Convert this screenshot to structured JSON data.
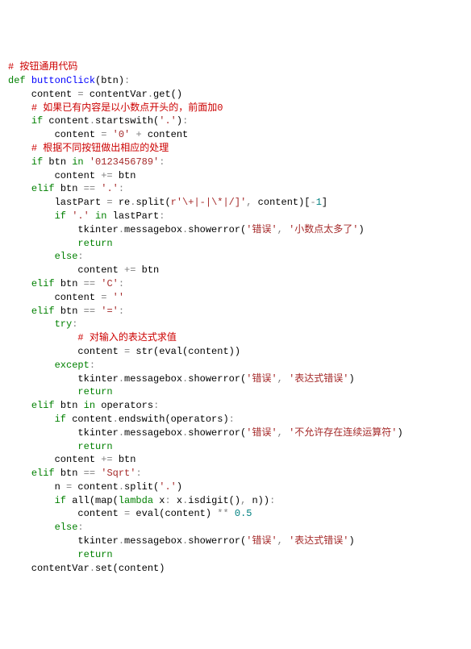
{
  "code": {
    "lines": [
      [
        [
          "cm",
          "# 按钮通用代码"
        ]
      ],
      [
        [
          "kw",
          "def "
        ],
        [
          "fn",
          "buttonClick"
        ],
        [
          "id",
          "(btn)"
        ],
        [
          "op",
          ":"
        ]
      ],
      [
        [
          "id",
          "    content "
        ],
        [
          "op",
          "="
        ],
        [
          "id",
          " contentVar"
        ],
        [
          "op",
          "."
        ],
        [
          "id",
          "get()"
        ]
      ],
      [
        [
          "id",
          "    "
        ],
        [
          "cm",
          "# 如果已有内容是以小数点开头的，前面加0"
        ]
      ],
      [
        [
          "id",
          "    "
        ],
        [
          "kw",
          "if"
        ],
        [
          "id",
          " content"
        ],
        [
          "op",
          "."
        ],
        [
          "id",
          "startswith("
        ],
        [
          "st",
          "'.'"
        ],
        [
          "id",
          ")"
        ],
        [
          "op",
          ":"
        ]
      ],
      [
        [
          "id",
          "        content "
        ],
        [
          "op",
          "="
        ],
        [
          "id",
          " "
        ],
        [
          "st",
          "'0'"
        ],
        [
          "id",
          " "
        ],
        [
          "op",
          "+"
        ],
        [
          "id",
          " content"
        ]
      ],
      [
        [
          "id",
          ""
        ]
      ],
      [
        [
          "id",
          "    "
        ],
        [
          "cm",
          "# 根据不同按钮做出相应的处理"
        ]
      ],
      [
        [
          "id",
          "    "
        ],
        [
          "kw",
          "if"
        ],
        [
          "id",
          " btn "
        ],
        [
          "kw",
          "in"
        ],
        [
          "id",
          " "
        ],
        [
          "st",
          "'0123456789'"
        ],
        [
          "op",
          ":"
        ]
      ],
      [
        [
          "id",
          "        content "
        ],
        [
          "op",
          "+="
        ],
        [
          "id",
          " btn"
        ]
      ],
      [
        [
          "id",
          "    "
        ],
        [
          "kw",
          "elif"
        ],
        [
          "id",
          " btn "
        ],
        [
          "op",
          "=="
        ],
        [
          "id",
          " "
        ],
        [
          "st",
          "'.'"
        ],
        [
          "op",
          ":"
        ]
      ],
      [
        [
          "id",
          "        lastPart "
        ],
        [
          "op",
          "="
        ],
        [
          "id",
          " re"
        ],
        [
          "op",
          "."
        ],
        [
          "id",
          "split("
        ],
        [
          "st",
          "r'\\+|-|\\*|/]'"
        ],
        [
          "op",
          ","
        ],
        [
          "id",
          " content)["
        ],
        [
          "op",
          "-"
        ],
        [
          "nm",
          "1"
        ],
        [
          "id",
          "]"
        ]
      ],
      [
        [
          "id",
          "        "
        ],
        [
          "kw",
          "if"
        ],
        [
          "id",
          " "
        ],
        [
          "st",
          "'.'"
        ],
        [
          "id",
          " "
        ],
        [
          "kw",
          "in"
        ],
        [
          "id",
          " lastPart"
        ],
        [
          "op",
          ":"
        ]
      ],
      [
        [
          "id",
          "            tkinter"
        ],
        [
          "op",
          "."
        ],
        [
          "id",
          "messagebox"
        ],
        [
          "op",
          "."
        ],
        [
          "id",
          "showerror("
        ],
        [
          "st",
          "'错误'"
        ],
        [
          "op",
          ","
        ],
        [
          "id",
          " "
        ],
        [
          "st",
          "'小数点太多了'"
        ],
        [
          "id",
          ")"
        ]
      ],
      [
        [
          "id",
          "            "
        ],
        [
          "kw",
          "return"
        ]
      ],
      [
        [
          "id",
          "        "
        ],
        [
          "kw",
          "else"
        ],
        [
          "op",
          ":"
        ]
      ],
      [
        [
          "id",
          "            content "
        ],
        [
          "op",
          "+="
        ],
        [
          "id",
          " btn"
        ]
      ],
      [
        [
          "id",
          "    "
        ],
        [
          "kw",
          "elif"
        ],
        [
          "id",
          " btn "
        ],
        [
          "op",
          "=="
        ],
        [
          "id",
          " "
        ],
        [
          "st",
          "'C'"
        ],
        [
          "op",
          ":"
        ]
      ],
      [
        [
          "id",
          "        content "
        ],
        [
          "op",
          "="
        ],
        [
          "id",
          " "
        ],
        [
          "st",
          "''"
        ]
      ],
      [
        [
          "id",
          "    "
        ],
        [
          "kw",
          "elif"
        ],
        [
          "id",
          " btn "
        ],
        [
          "op",
          "=="
        ],
        [
          "id",
          " "
        ],
        [
          "st",
          "'='"
        ],
        [
          "op",
          ":"
        ]
      ],
      [
        [
          "id",
          "        "
        ],
        [
          "kw",
          "try"
        ],
        [
          "op",
          ":"
        ]
      ],
      [
        [
          "id",
          "            "
        ],
        [
          "cm",
          "# 对输入的表达式求值"
        ]
      ],
      [
        [
          "id",
          "            content "
        ],
        [
          "op",
          "="
        ],
        [
          "id",
          " str(eval(content))"
        ]
      ],
      [
        [
          "id",
          "        "
        ],
        [
          "kw",
          "except"
        ],
        [
          "op",
          ":"
        ]
      ],
      [
        [
          "id",
          "            tkinter"
        ],
        [
          "op",
          "."
        ],
        [
          "id",
          "messagebox"
        ],
        [
          "op",
          "."
        ],
        [
          "id",
          "showerror("
        ],
        [
          "st",
          "'错误'"
        ],
        [
          "op",
          ","
        ],
        [
          "id",
          " "
        ],
        [
          "st",
          "'表达式错误'"
        ],
        [
          "id",
          ")"
        ]
      ],
      [
        [
          "id",
          "            "
        ],
        [
          "kw",
          "return"
        ]
      ],
      [
        [
          "id",
          "    "
        ],
        [
          "kw",
          "elif"
        ],
        [
          "id",
          " btn "
        ],
        [
          "kw",
          "in"
        ],
        [
          "id",
          " operators"
        ],
        [
          "op",
          ":"
        ]
      ],
      [
        [
          "id",
          "        "
        ],
        [
          "kw",
          "if"
        ],
        [
          "id",
          " content"
        ],
        [
          "op",
          "."
        ],
        [
          "id",
          "endswith(operators)"
        ],
        [
          "op",
          ":"
        ]
      ],
      [
        [
          "id",
          "            tkinter"
        ],
        [
          "op",
          "."
        ],
        [
          "id",
          "messagebox"
        ],
        [
          "op",
          "."
        ],
        [
          "id",
          "showerror("
        ],
        [
          "st",
          "'错误'"
        ],
        [
          "op",
          ","
        ],
        [
          "id",
          " "
        ],
        [
          "st",
          "'不允许存在连续运算符'"
        ],
        [
          "id",
          ")"
        ]
      ],
      [
        [
          "id",
          "            "
        ],
        [
          "kw",
          "return"
        ]
      ],
      [
        [
          "id",
          "        content "
        ],
        [
          "op",
          "+="
        ],
        [
          "id",
          " btn"
        ]
      ],
      [
        [
          "id",
          "    "
        ],
        [
          "kw",
          "elif"
        ],
        [
          "id",
          " btn "
        ],
        [
          "op",
          "=="
        ],
        [
          "id",
          " "
        ],
        [
          "st",
          "'Sqrt'"
        ],
        [
          "op",
          ":"
        ]
      ],
      [
        [
          "id",
          "        n "
        ],
        [
          "op",
          "="
        ],
        [
          "id",
          " content"
        ],
        [
          "op",
          "."
        ],
        [
          "id",
          "split("
        ],
        [
          "st",
          "'.'"
        ],
        [
          "id",
          ")"
        ]
      ],
      [
        [
          "id",
          "        "
        ],
        [
          "kw",
          "if"
        ],
        [
          "id",
          " all(map("
        ],
        [
          "kw",
          "lambda"
        ],
        [
          "id",
          " x"
        ],
        [
          "op",
          ":"
        ],
        [
          "id",
          " x"
        ],
        [
          "op",
          "."
        ],
        [
          "id",
          "isdigit()"
        ],
        [
          "op",
          ","
        ],
        [
          "id",
          " n))"
        ],
        [
          "op",
          ":"
        ]
      ],
      [
        [
          "id",
          "            content "
        ],
        [
          "op",
          "="
        ],
        [
          "id",
          " eval(content) "
        ],
        [
          "op",
          "**"
        ],
        [
          "id",
          " "
        ],
        [
          "nm",
          "0.5"
        ]
      ],
      [
        [
          "id",
          "        "
        ],
        [
          "kw",
          "else"
        ],
        [
          "op",
          ":"
        ]
      ],
      [
        [
          "id",
          "            tkinter"
        ],
        [
          "op",
          "."
        ],
        [
          "id",
          "messagebox"
        ],
        [
          "op",
          "."
        ],
        [
          "id",
          "showerror("
        ],
        [
          "st",
          "'错误'"
        ],
        [
          "op",
          ","
        ],
        [
          "id",
          " "
        ],
        [
          "st",
          "'表达式错误'"
        ],
        [
          "id",
          ")"
        ]
      ],
      [
        [
          "id",
          "            "
        ],
        [
          "kw",
          "return"
        ]
      ],
      [
        [
          "id",
          ""
        ]
      ],
      [
        [
          "id",
          "    contentVar"
        ],
        [
          "op",
          "."
        ],
        [
          "id",
          "set(content)"
        ]
      ]
    ]
  }
}
